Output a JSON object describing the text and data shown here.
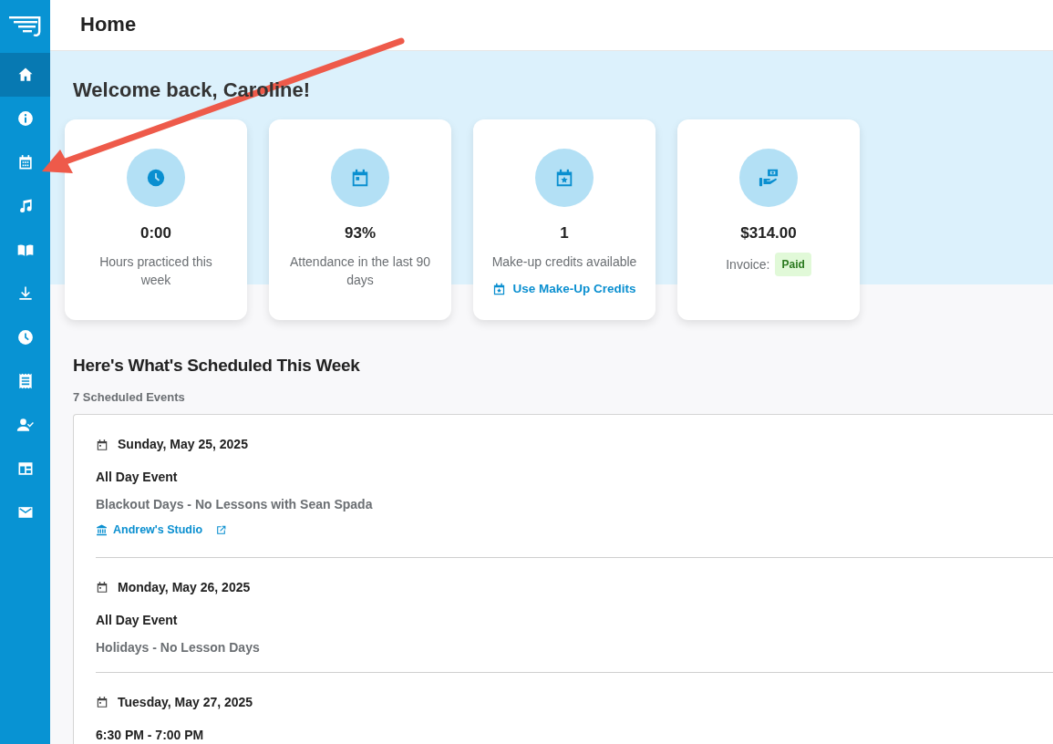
{
  "sidebar": {
    "items": [
      {
        "selected": true
      },
      {
        "selected": false
      },
      {
        "selected": false
      },
      {
        "selected": false
      },
      {
        "selected": false
      },
      {
        "selected": false
      },
      {
        "selected": false
      },
      {
        "selected": false
      },
      {
        "selected": false
      },
      {
        "selected": false
      },
      {
        "selected": false
      }
    ]
  },
  "header": {
    "title": "Home"
  },
  "welcome": "Welcome back, Caroline!",
  "stats": [
    {
      "kind": "hours",
      "value": "0:00",
      "label": "Hours practiced this week"
    },
    {
      "kind": "attendance",
      "value": "93%",
      "label": "Attendance in the last 90 days"
    },
    {
      "kind": "credits",
      "value": "1",
      "label": "Make-up credits available",
      "link": "Use Make-Up Credits"
    },
    {
      "kind": "invoice",
      "value": "$314.00",
      "label": "Invoice:",
      "badge": "Paid"
    }
  ],
  "schedule": {
    "title": "Here's What's Scheduled This Week",
    "count": "7 Scheduled Events",
    "days": [
      {
        "date": "Sunday, May 25, 2025",
        "events": [
          {
            "time": "All Day Event",
            "title": "Blackout Days - No Lessons with Sean Spada",
            "studio": "Andrew's Studio"
          }
        ]
      },
      {
        "date": "Monday, May 26, 2025",
        "events": [
          {
            "time": "All Day Event",
            "title": "Holidays - No Lesson Days"
          }
        ]
      },
      {
        "date": "Tuesday, May 27, 2025",
        "events": [
          {
            "time": "6:30 PM - 7:00 PM"
          }
        ]
      }
    ]
  }
}
